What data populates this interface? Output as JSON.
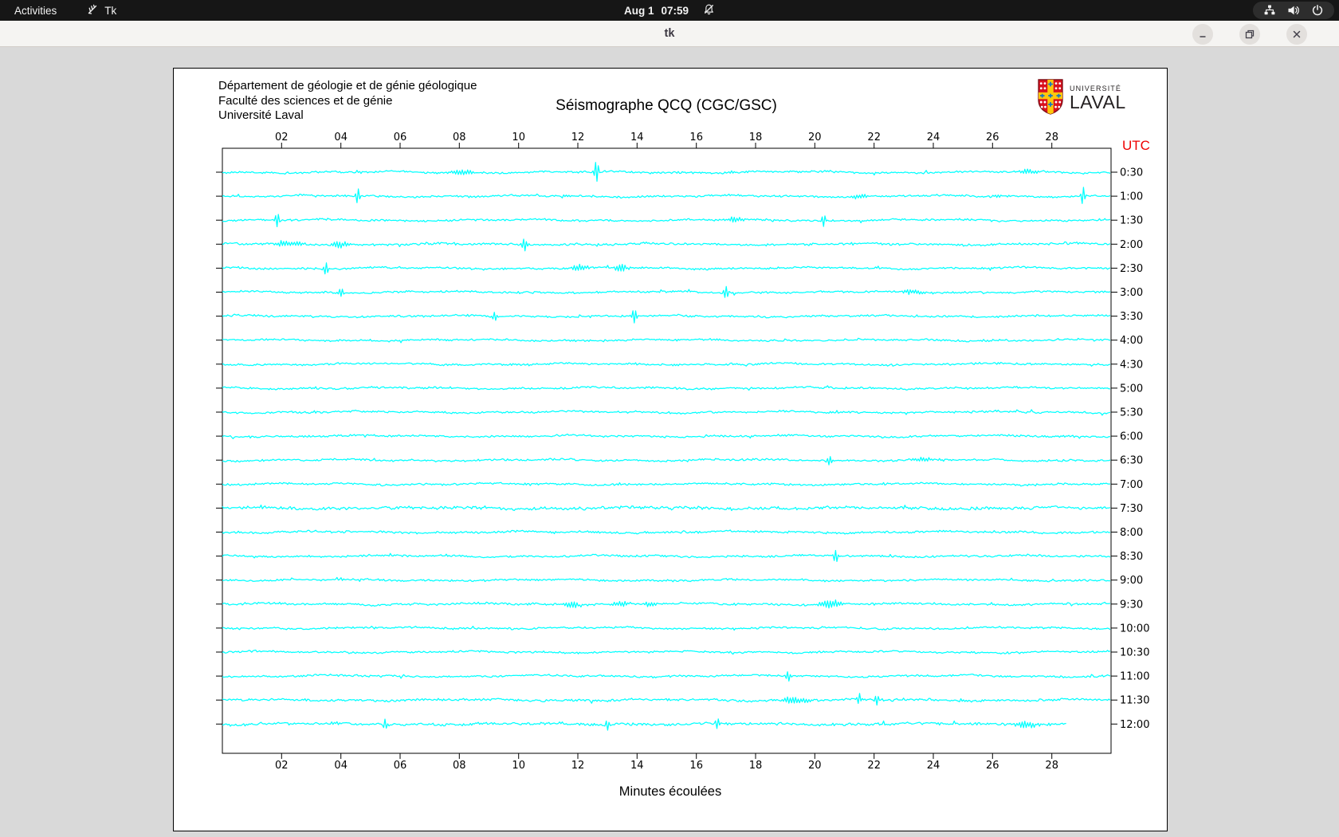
{
  "top_bar": {
    "activities": "Activities",
    "app_name": "Tk",
    "date": "Aug 1",
    "time": "07:59",
    "icons": [
      "tk-app-icon",
      "notifications-muted-icon",
      "network-icon",
      "volume-icon",
      "power-icon"
    ]
  },
  "title_bar": {
    "title": "tk",
    "window_controls": [
      "minimize",
      "restore",
      "close"
    ]
  },
  "seismograph": {
    "header_lines": [
      "Département de géologie et de génie géologique",
      "Faculté des sciences et de génie",
      "Université Laval"
    ],
    "logo_line1": "UNIVERSITÉ",
    "logo_line2": "LAVAL"
  },
  "colors": {
    "trace": "#00ffff",
    "axis": "#000000",
    "utc_red": "#ee0000",
    "shield_red": "#d9121f",
    "shield_dark": "#7c0d16",
    "shield_gold": "#fdc70c",
    "shield_blue": "#1b79c0"
  },
  "chart_data": {
    "type": "line",
    "title": "Séismographe QCQ (CGC/GSC)",
    "xlabel": "Minutes écoulées",
    "utc_label": "UTC",
    "x_range_minutes": [
      0,
      30
    ],
    "x_ticks": [
      "02",
      "04",
      "06",
      "08",
      "10",
      "12",
      "14",
      "16",
      "18",
      "20",
      "22",
      "24",
      "26",
      "28"
    ],
    "grid": false,
    "rows": [
      {
        "label": "0:30",
        "base_noise": 1.1,
        "spikes": [
          {
            "m": 8.1,
            "a": 2.5,
            "w": 0.4
          },
          {
            "m": 12.63,
            "a": 13,
            "w": 0.07
          },
          {
            "m": 17.2,
            "a": 2.2,
            "w": 0.12
          },
          {
            "m": 27.2,
            "a": 2.2,
            "w": 0.35
          }
        ]
      },
      {
        "label": "1:00",
        "base_noise": 1.1,
        "spikes": [
          {
            "m": 4.57,
            "a": 9,
            "w": 0.07
          },
          {
            "m": 21.55,
            "a": 2.2,
            "w": 0.3
          },
          {
            "m": 26.2,
            "a": 2.0,
            "w": 0.1
          },
          {
            "m": 29.05,
            "a": 11,
            "w": 0.06
          }
        ]
      },
      {
        "label": "1:30",
        "base_noise": 1.1,
        "spikes": [
          {
            "m": 1.85,
            "a": 9,
            "w": 0.07
          },
          {
            "m": 17.3,
            "a": 2.5,
            "w": 0.3
          },
          {
            "m": 20.3,
            "a": 8,
            "w": 0.07
          }
        ]
      },
      {
        "label": "2:00",
        "base_noise": 1.3,
        "spikes": [
          {
            "m": 2.15,
            "a": 3,
            "w": 0.5
          },
          {
            "m": 3.95,
            "a": 3.5,
            "w": 0.25
          },
          {
            "m": 10.2,
            "a": 7,
            "w": 0.08
          }
        ]
      },
      {
        "label": "2:30",
        "base_noise": 1.1,
        "spikes": [
          {
            "m": 3.5,
            "a": 8,
            "w": 0.07
          },
          {
            "m": 12.05,
            "a": 3.5,
            "w": 0.3
          },
          {
            "m": 13.45,
            "a": 4.5,
            "w": 0.2
          }
        ]
      },
      {
        "label": "3:00",
        "base_noise": 1.1,
        "spikes": [
          {
            "m": 4.0,
            "a": 6,
            "w": 0.07
          },
          {
            "m": 17.0,
            "a": 8,
            "w": 0.07
          },
          {
            "m": 23.3,
            "a": 2.5,
            "w": 0.4
          }
        ]
      },
      {
        "label": "3:30",
        "base_noise": 1.1,
        "spikes": [
          {
            "m": 9.2,
            "a": 5,
            "w": 0.08
          },
          {
            "m": 13.9,
            "a": 8.5,
            "w": 0.08
          }
        ]
      },
      {
        "label": "4:00",
        "base_noise": 1.1,
        "spikes": []
      },
      {
        "label": "4:30",
        "base_noise": 1.1,
        "spikes": []
      },
      {
        "label": "5:00",
        "base_noise": 1.1,
        "spikes": []
      },
      {
        "label": "5:30",
        "base_noise": 1.1,
        "spikes": []
      },
      {
        "label": "6:00",
        "base_noise": 1.1,
        "spikes": []
      },
      {
        "label": "6:30",
        "base_noise": 1.1,
        "spikes": [
          {
            "m": 20.5,
            "a": 6,
            "w": 0.08
          },
          {
            "m": 23.7,
            "a": 2.2,
            "w": 0.25
          }
        ]
      },
      {
        "label": "7:00",
        "base_noise": 1.1,
        "spikes": []
      },
      {
        "label": "7:30",
        "base_noise": 1.7,
        "spikes": []
      },
      {
        "label": "8:00",
        "base_noise": 1.2,
        "spikes": []
      },
      {
        "label": "8:30",
        "base_noise": 1.1,
        "spikes": [
          {
            "m": 20.7,
            "a": 7,
            "w": 0.08
          }
        ]
      },
      {
        "label": "9:00",
        "base_noise": 1.1,
        "spikes": []
      },
      {
        "label": "9:30",
        "base_noise": 1.2,
        "spikes": [
          {
            "m": 11.8,
            "a": 3,
            "w": 0.3
          },
          {
            "m": 13.5,
            "a": 2.8,
            "w": 0.25
          },
          {
            "m": 14.4,
            "a": 2.6,
            "w": 0.2
          },
          {
            "m": 20.5,
            "a": 4.5,
            "w": 0.35
          }
        ]
      },
      {
        "label": "10:00",
        "base_noise": 1.1,
        "spikes": []
      },
      {
        "label": "10:30",
        "base_noise": 1.1,
        "spikes": []
      },
      {
        "label": "11:00",
        "base_noise": 1.1,
        "spikes": [
          {
            "m": 19.1,
            "a": 6,
            "w": 0.08
          }
        ]
      },
      {
        "label": "11:30",
        "base_noise": 1.3,
        "spikes": [
          {
            "m": 19.3,
            "a": 3.5,
            "w": 0.45
          },
          {
            "m": 21.5,
            "a": 6,
            "w": 0.07
          },
          {
            "m": 22.1,
            "a": 6,
            "w": 0.07
          }
        ]
      },
      {
        "label": "12:00",
        "base_noise": 1.5,
        "end_minute": 28.5,
        "spikes": [
          {
            "m": 5.5,
            "a": 6,
            "w": 0.07
          },
          {
            "m": 13.0,
            "a": 6.5,
            "w": 0.07
          },
          {
            "m": 16.7,
            "a": 7,
            "w": 0.07
          },
          {
            "m": 27.1,
            "a": 3,
            "w": 0.35
          }
        ]
      }
    ]
  }
}
